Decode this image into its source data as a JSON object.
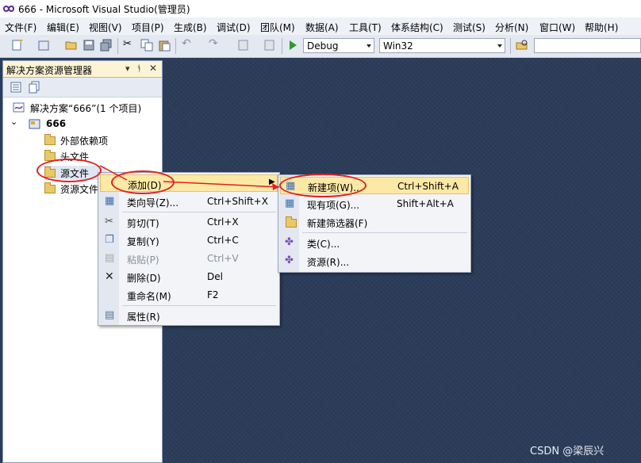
{
  "window": {
    "title": "666 - Microsoft Visual Studio(管理员)"
  },
  "menubar": [
    "文件(F)",
    "编辑(E)",
    "视图(V)",
    "项目(P)",
    "生成(B)",
    "调试(D)",
    "团队(M)",
    "数据(A)",
    "工具(T)",
    "体系结构(C)",
    "测试(S)",
    "分析(N)",
    "窗口(W)",
    "帮助(H)"
  ],
  "toolbar": {
    "config": "Debug",
    "platform": "Win32",
    "search_value": ""
  },
  "explorer": {
    "title": "解决方案资源管理器",
    "pin_glyph": "▾ ₽ ✕",
    "solution": "解决方案“666”(1 个项目)",
    "project": "666",
    "nodes": [
      "外部依赖项",
      "头文件",
      "源文件",
      "资源文件"
    ]
  },
  "context_menu": {
    "items": [
      {
        "label": "添加(D)",
        "shortcut": "",
        "icon": "none"
      },
      {
        "label": "类向导(Z)...",
        "shortcut": "Ctrl+Shift+X",
        "icon": "wizard-icon"
      },
      {
        "label": "剪切(T)",
        "shortcut": "Ctrl+X",
        "icon": "scissors-icon"
      },
      {
        "label": "复制(Y)",
        "shortcut": "Ctrl+C",
        "icon": "copy-icon"
      },
      {
        "label": "粘贴(P)",
        "shortcut": "Ctrl+V",
        "icon": "paste-icon"
      },
      {
        "label": "删除(D)",
        "shortcut": "Del",
        "icon": "delete-icon"
      },
      {
        "label": "重命名(M)",
        "shortcut": "F2",
        "icon": "none"
      },
      {
        "label": "属性(R)",
        "shortcut": "",
        "icon": "properties-icon"
      }
    ]
  },
  "add_submenu": {
    "items": [
      {
        "label": "新建项(W)...",
        "shortcut": "Ctrl+Shift+A",
        "icon": "new-item-icon"
      },
      {
        "label": "现有项(G)...",
        "shortcut": "Shift+Alt+A",
        "icon": "existing-item-icon"
      },
      {
        "label": "新建筛选器(F)",
        "shortcut": "",
        "icon": "folder-icon"
      },
      {
        "label": "类(C)...",
        "shortcut": "",
        "icon": "class-icon"
      },
      {
        "label": "资源(R)...",
        "shortcut": "",
        "icon": "resource-icon"
      }
    ]
  },
  "watermark": "CSDN @梁辰兴",
  "colors": {
    "editor_bg": "#2b3c59",
    "highlight": "#fde9a6",
    "annotation": "#e02020"
  }
}
